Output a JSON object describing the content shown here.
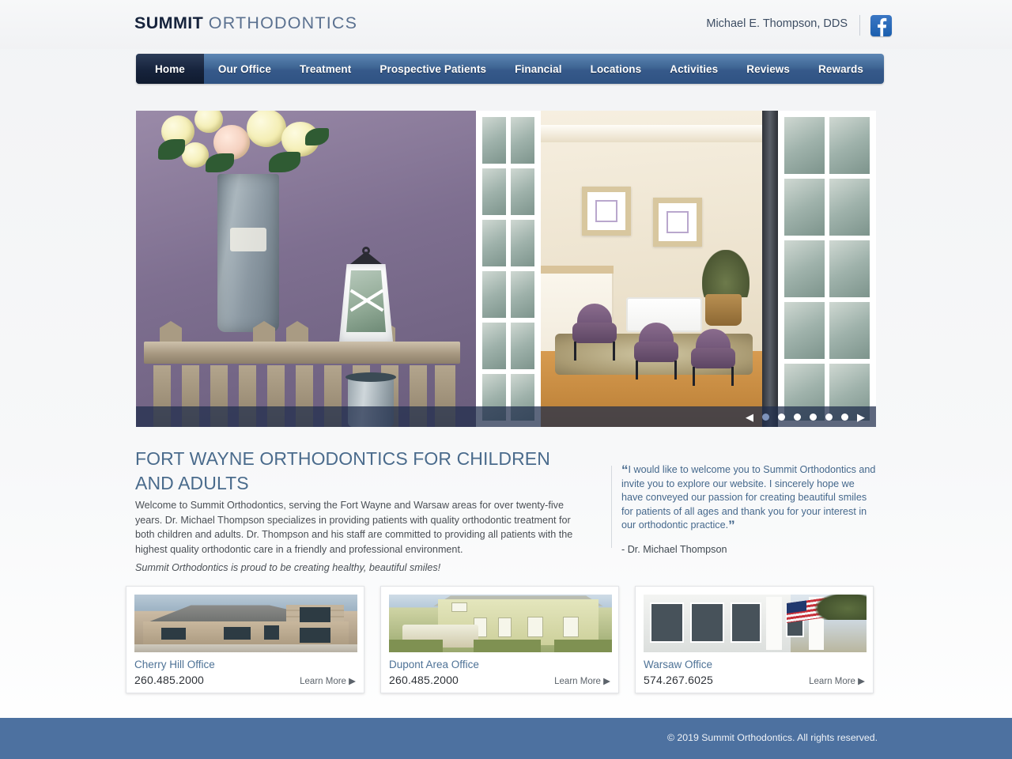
{
  "site": {
    "logo_bold": "SUMMIT",
    "logo_light": "ORTHODONTICS",
    "doctor_name": "Michael E. Thompson, DDS",
    "facebook_icon": "facebook-icon",
    "accent_blue": "#4d71a0",
    "nav_active_color": "#16233c",
    "heading_color": "#4a6b8c"
  },
  "nav": {
    "items": [
      {
        "label": "Home",
        "active": true
      },
      {
        "label": "Our Office",
        "active": false
      },
      {
        "label": "Treatment",
        "active": false
      },
      {
        "label": "Prospective Patients",
        "active": false
      },
      {
        "label": "Financial",
        "active": false
      },
      {
        "label": "Locations",
        "active": false
      },
      {
        "label": "Activities",
        "active": false
      },
      {
        "label": "Reviews",
        "active": false
      },
      {
        "label": "Rewards",
        "active": false
      }
    ]
  },
  "hero": {
    "prev_label": "◀",
    "next_label": "▶",
    "slide_count": 6,
    "active_slide": 1
  },
  "main": {
    "heading": "FORT WAYNE ORTHODONTICS FOR CHILDREN AND ADULTS",
    "paragraph": "Welcome to Summit Orthodontics, serving the Fort Wayne and Warsaw areas for over twenty-five years. Dr. Michael Thompson specializes in providing patients with quality orthodontic treatment for both children and adults. Dr. Thompson and his staff are committed to providing all patients with the highest quality orthodontic care in a friendly and professional environment.",
    "tagline": "Summit Orthodontics is proud to be creating healthy, beautiful smiles!"
  },
  "quote": {
    "open_mark": "“",
    "close_mark": "”",
    "text": "I would like to welcome you to Summit Orthodontics and invite you to explore our website. I sincerely hope we have conveyed our passion for creating beautiful smiles for patients of all ages and thank you for your interest in our orthodontic practice.",
    "attribution": "- Dr. Michael Thompson"
  },
  "offices": [
    {
      "name": "Cherry Hill Office",
      "phone": "260.485.2000",
      "more_label": "Learn More ▶",
      "photo_alt": "cherry-hill-office-building"
    },
    {
      "name": "Dupont Area Office",
      "phone": "260.485.2000",
      "more_label": "Learn More ▶",
      "photo_alt": "dupont-area-office-building"
    },
    {
      "name": "Warsaw Office",
      "phone": "574.267.6025",
      "more_label": "Learn More ▶",
      "photo_alt": "warsaw-office-building"
    }
  ],
  "footer": {
    "copyright": "© 2019 Summit Orthodontics. All rights reserved."
  }
}
